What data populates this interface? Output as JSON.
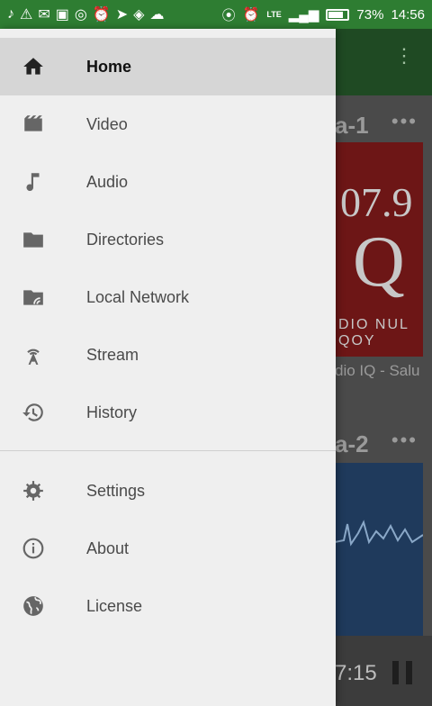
{
  "status_bar": {
    "battery_percent": "73%",
    "battery_level": 0.73,
    "time": "14:56",
    "network": "LTE"
  },
  "drawer": {
    "primary_items": [
      {
        "label": "Home",
        "icon": "home-icon",
        "active": true
      },
      {
        "label": "Video",
        "icon": "video-icon"
      },
      {
        "label": "Audio",
        "icon": "music-note-icon"
      },
      {
        "label": "Directories",
        "icon": "folder-icon"
      },
      {
        "label": "Local Network",
        "icon": "network-folder-icon"
      },
      {
        "label": "Stream",
        "icon": "antenna-icon"
      },
      {
        "label": "History",
        "icon": "history-icon"
      }
    ],
    "secondary_items": [
      {
        "label": "Settings",
        "icon": "gear-icon"
      },
      {
        "label": "About",
        "icon": "info-icon"
      },
      {
        "label": "License",
        "icon": "globe-icon"
      }
    ]
  },
  "background": {
    "section_1_title": "a-1",
    "section_2_title": "a-2",
    "card_1_text_top": "07.9",
    "card_1_text_mid": "Q",
    "card_1_text_bottom": "DIO NUL QOY",
    "card_1_caption": "dio IQ - Salu",
    "player_time": "7:15"
  },
  "colors": {
    "status_bar": "#2e7d32",
    "drawer_bg": "#efefef",
    "active_item_bg": "#d6d6d6"
  }
}
